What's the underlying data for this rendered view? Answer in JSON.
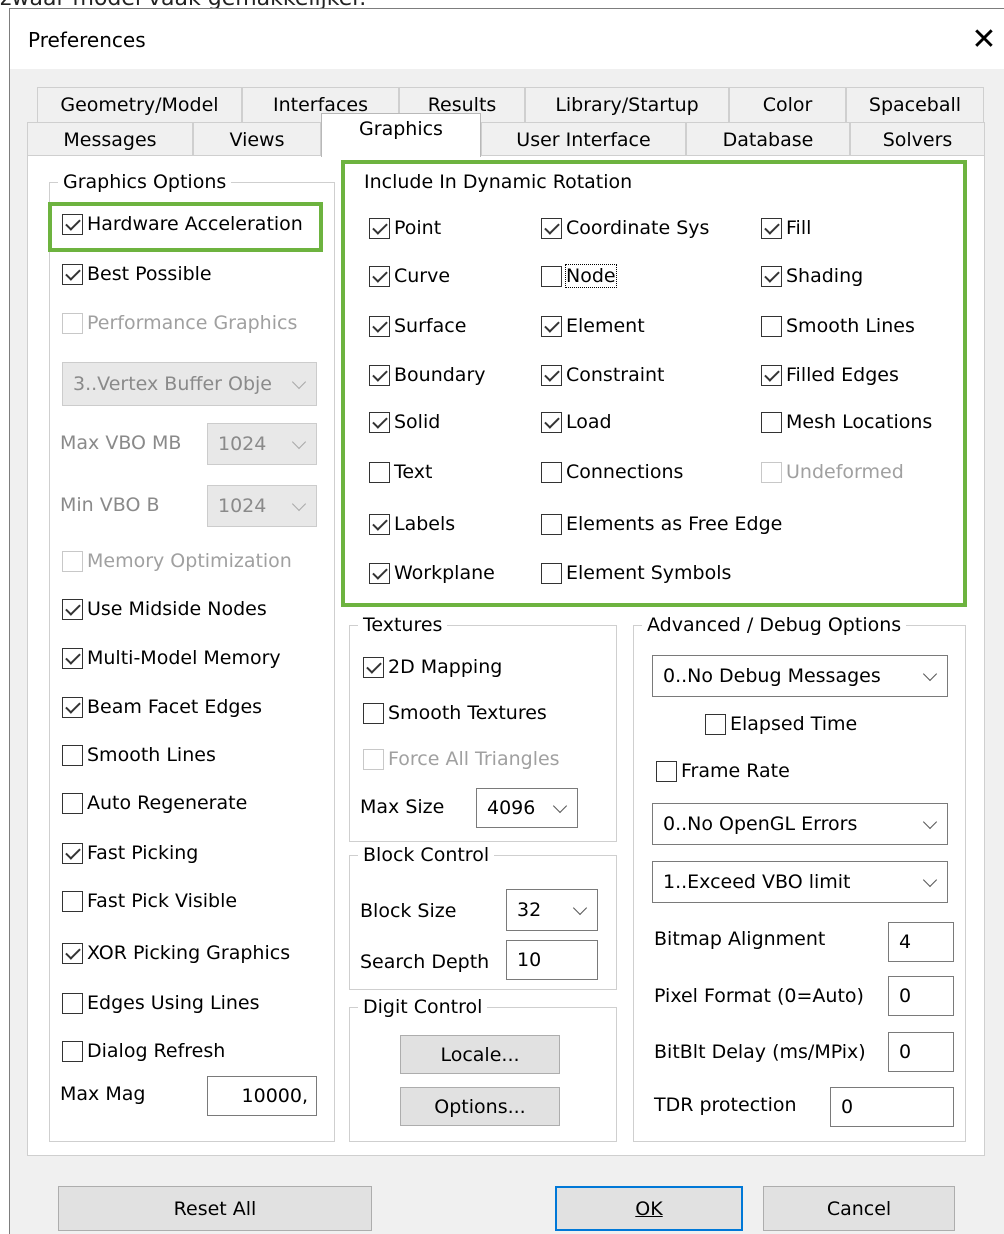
{
  "page_top_text": "zwaar model vaak gemakkelijker.",
  "window": {
    "title": "Preferences",
    "close_glyph": "✕"
  },
  "tabs": {
    "row1": [
      "Geometry/Model",
      "Interfaces",
      "Results",
      "Library/Startup",
      "Color",
      "Spaceball"
    ],
    "row2": [
      "Messages",
      "Views",
      "Graphics",
      "User Interface",
      "Database",
      "Solvers"
    ],
    "active": "Graphics"
  },
  "graphics_options": {
    "title": "Graphics Options",
    "hardware_acceleration": {
      "label": "Hardware Acceleration",
      "checked": true
    },
    "best_possible": {
      "label": "Best Possible",
      "checked": true
    },
    "performance_graphics": {
      "label": "Performance Graphics",
      "checked": false,
      "disabled": true
    },
    "vbo_mode": "3..Vertex Buffer Obje",
    "max_vbo_label": "Max VBO MB",
    "max_vbo_value": "1024",
    "min_vbo_label": "Min VBO B",
    "min_vbo_value": "1024",
    "memory_optimization": {
      "label": "Memory Optimization",
      "checked": false,
      "disabled": true
    },
    "use_midside_nodes": {
      "label": "Use Midside Nodes",
      "checked": true
    },
    "multi_model_memory": {
      "label": "Multi-Model Memory",
      "checked": true
    },
    "beam_facet_edges": {
      "label": "Beam Facet Edges",
      "checked": true
    },
    "smooth_lines": {
      "label": "Smooth Lines",
      "checked": false
    },
    "auto_regenerate": {
      "label": "Auto Regenerate",
      "checked": false
    },
    "fast_picking": {
      "label": "Fast Picking",
      "checked": true
    },
    "fast_pick_visible": {
      "label": "Fast Pick Visible",
      "checked": false
    },
    "xor_picking_graphics": {
      "label": "XOR Picking Graphics",
      "checked": true
    },
    "edges_using_lines": {
      "label": "Edges Using Lines",
      "checked": false
    },
    "dialog_refresh": {
      "label": "Dialog Refresh",
      "checked": false
    },
    "max_mag_label": "Max Mag",
    "max_mag_value": "10000,"
  },
  "dynamic_rotation": {
    "title": "Include In Dynamic Rotation",
    "point": {
      "label": "Point",
      "checked": true
    },
    "curve": {
      "label": "Curve",
      "checked": true
    },
    "surface": {
      "label": "Surface",
      "checked": true
    },
    "boundary": {
      "label": "Boundary",
      "checked": true
    },
    "solid": {
      "label": "Solid",
      "checked": true
    },
    "text": {
      "label": "Text",
      "checked": false
    },
    "labels": {
      "label": "Labels",
      "checked": true
    },
    "workplane": {
      "label": "Workplane",
      "checked": true
    },
    "coordinate_sys": {
      "label": "Coordinate Sys",
      "checked": true
    },
    "node": {
      "label": "Node",
      "checked": false
    },
    "element": {
      "label": "Element",
      "checked": true
    },
    "constraint": {
      "label": "Constraint",
      "checked": true
    },
    "load": {
      "label": "Load",
      "checked": true
    },
    "connections": {
      "label": "Connections",
      "checked": false
    },
    "elements_as_free_edge": {
      "label": "Elements as Free Edge",
      "checked": false
    },
    "element_symbols": {
      "label": "Element Symbols",
      "checked": false
    },
    "fill": {
      "label": "Fill",
      "checked": true
    },
    "shading": {
      "label": "Shading",
      "checked": true
    },
    "smooth_lines": {
      "label": "Smooth Lines",
      "checked": false
    },
    "filled_edges": {
      "label": "Filled Edges",
      "checked": true
    },
    "mesh_locations": {
      "label": "Mesh Locations",
      "checked": false
    },
    "undeformed": {
      "label": "Undeformed",
      "checked": false,
      "disabled": true
    }
  },
  "textures": {
    "title": "Textures",
    "mapping_2d": {
      "label": "2D Mapping",
      "checked": true
    },
    "smooth_textures": {
      "label": "Smooth Textures",
      "checked": false
    },
    "force_all_triangles": {
      "label": "Force All Triangles",
      "checked": false,
      "disabled": true
    },
    "max_size_label": "Max Size",
    "max_size_value": "4096"
  },
  "block_control": {
    "title": "Block Control",
    "block_size_label": "Block Size",
    "block_size_value": "32",
    "search_depth_label": "Search Depth",
    "search_depth_value": "10"
  },
  "digit_control": {
    "title": "Digit Control",
    "locale_label": "Locale...",
    "options_label": "Options..."
  },
  "advanced": {
    "title": "Advanced / Debug Options",
    "debug_messages": "0..No Debug Messages",
    "elapsed_time": {
      "label": "Elapsed Time",
      "checked": false
    },
    "frame_rate": {
      "label": "Frame Rate",
      "checked": false
    },
    "opengl_errors": "0..No OpenGL Errors",
    "vbo_limit": "1..Exceed VBO limit",
    "bitmap_alignment_label": "Bitmap Alignment",
    "bitmap_alignment_value": "4",
    "pixel_format_label": "Pixel Format (0=Auto)",
    "pixel_format_value": "0",
    "bitblt_delay_label": "BitBlt Delay (ms/MPix)",
    "bitblt_delay_value": "0",
    "tdr_protection_label": "TDR protection",
    "tdr_protection_value": "0"
  },
  "buttons": {
    "reset_all": "Reset All",
    "ok": "OK",
    "cancel": "Cancel"
  },
  "colors": {
    "highlight": "#6db33f",
    "default_button_border": "#0078d7"
  }
}
